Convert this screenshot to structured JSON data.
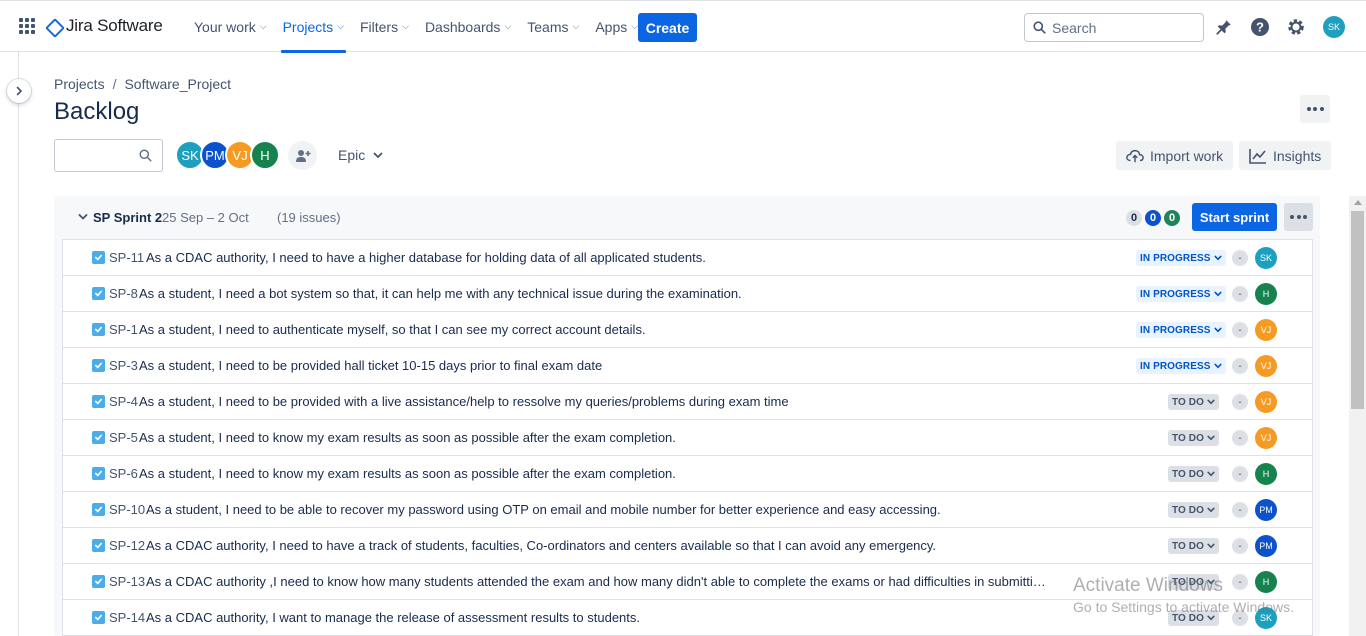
{
  "topnav": {
    "app_name": "Jira Software",
    "items": [
      {
        "label": "Your work",
        "active": false
      },
      {
        "label": "Projects",
        "active": true
      },
      {
        "label": "Filters",
        "active": false
      },
      {
        "label": "Dashboards",
        "active": false
      },
      {
        "label": "Teams",
        "active": false
      },
      {
        "label": "Apps",
        "active": false
      }
    ],
    "create_label": "Create",
    "search_placeholder": "Search",
    "user_initials": "SK"
  },
  "breadcrumb": {
    "projects": "Projects",
    "separator": "/",
    "project": "Software_Project"
  },
  "page_title": "Backlog",
  "filters": {
    "avatars": [
      {
        "initials": "SK",
        "color": "#1d9fbf"
      },
      {
        "initials": "PM",
        "color": "#0c52cc"
      },
      {
        "initials": "VJ",
        "color": "#f59a23"
      },
      {
        "initials": "H",
        "color": "#16834f"
      }
    ],
    "epic_label": "Epic",
    "import_label": "Import work",
    "insights_label": "Insights"
  },
  "sprint": {
    "name": "SP Sprint 2",
    "dates": "25 Sep – 2 Oct",
    "issue_count": "(19 issues)",
    "counts": [
      "0",
      "0",
      "0"
    ],
    "start_label": "Start sprint",
    "issues": [
      {
        "key": "SP-11",
        "summary": "As a CDAC authority, I need to have a higher database for holding data of all applicated students.",
        "status": "IN PROGRESS",
        "estimate": "-",
        "assignee": "SK",
        "color": "#1d9fbf"
      },
      {
        "key": "SP-8",
        "summary": "As a student, I need a bot system so that, it can help me with any technical issue during the examination.",
        "status": "IN PROGRESS",
        "estimate": "-",
        "assignee": "H",
        "color": "#16834f"
      },
      {
        "key": "SP-1",
        "summary": "As a student, I need to authenticate myself, so that I can see my correct account details.",
        "status": "IN PROGRESS",
        "estimate": "-",
        "assignee": "VJ",
        "color": "#f59a23"
      },
      {
        "key": "SP-3",
        "summary": "As a student, I need to be provided hall ticket 10-15 days prior to final exam date",
        "status": "IN PROGRESS",
        "estimate": "-",
        "assignee": "VJ",
        "color": "#f59a23"
      },
      {
        "key": "SP-4",
        "summary": "As a student, I need to be provided with a live assistance/help to ressolve my queries/problems during exam time",
        "status": "TO DO",
        "estimate": "-",
        "assignee": "VJ",
        "color": "#f59a23"
      },
      {
        "key": "SP-5",
        "summary": "As a student, I need to know my exam results as soon as possible after the exam completion.",
        "status": "TO DO",
        "estimate": "-",
        "assignee": "VJ",
        "color": "#f59a23"
      },
      {
        "key": "SP-6",
        "summary": "As a student, I need to know my exam results as soon as possible after the exam completion.",
        "status": "TO DO",
        "estimate": "-",
        "assignee": "H",
        "color": "#16834f"
      },
      {
        "key": "SP-10",
        "summary": "As a student, I need to be able to recover my password using OTP on email and mobile number for better experience and easy accessing.",
        "status": "TO DO",
        "estimate": "-",
        "assignee": "PM",
        "color": "#0c52cc"
      },
      {
        "key": "SP-12",
        "summary": "As a CDAC authority, I need to have a track of students, faculties, Co-ordinators and centers available so that I can avoid any emergency.",
        "status": "TO DO",
        "estimate": "-",
        "assignee": "PM",
        "color": "#0c52cc"
      },
      {
        "key": "SP-13",
        "summary": "As a CDAC authority ,I need to know how many students attended the exam and how many didn't able to complete the exams or had difficulties in submitting ans..",
        "status": "TO DO",
        "estimate": "-",
        "assignee": "H",
        "color": "#16834f"
      },
      {
        "key": "SP-14",
        "summary": "As a CDAC authority, I want to manage the release of assessment results to students.",
        "status": "TO DO",
        "estimate": "-",
        "assignee": "SK",
        "color": "#1d9fbf"
      }
    ]
  },
  "watermark": {
    "title": "Activate Windows",
    "subtitle": "Go to Settings to activate Windows."
  }
}
